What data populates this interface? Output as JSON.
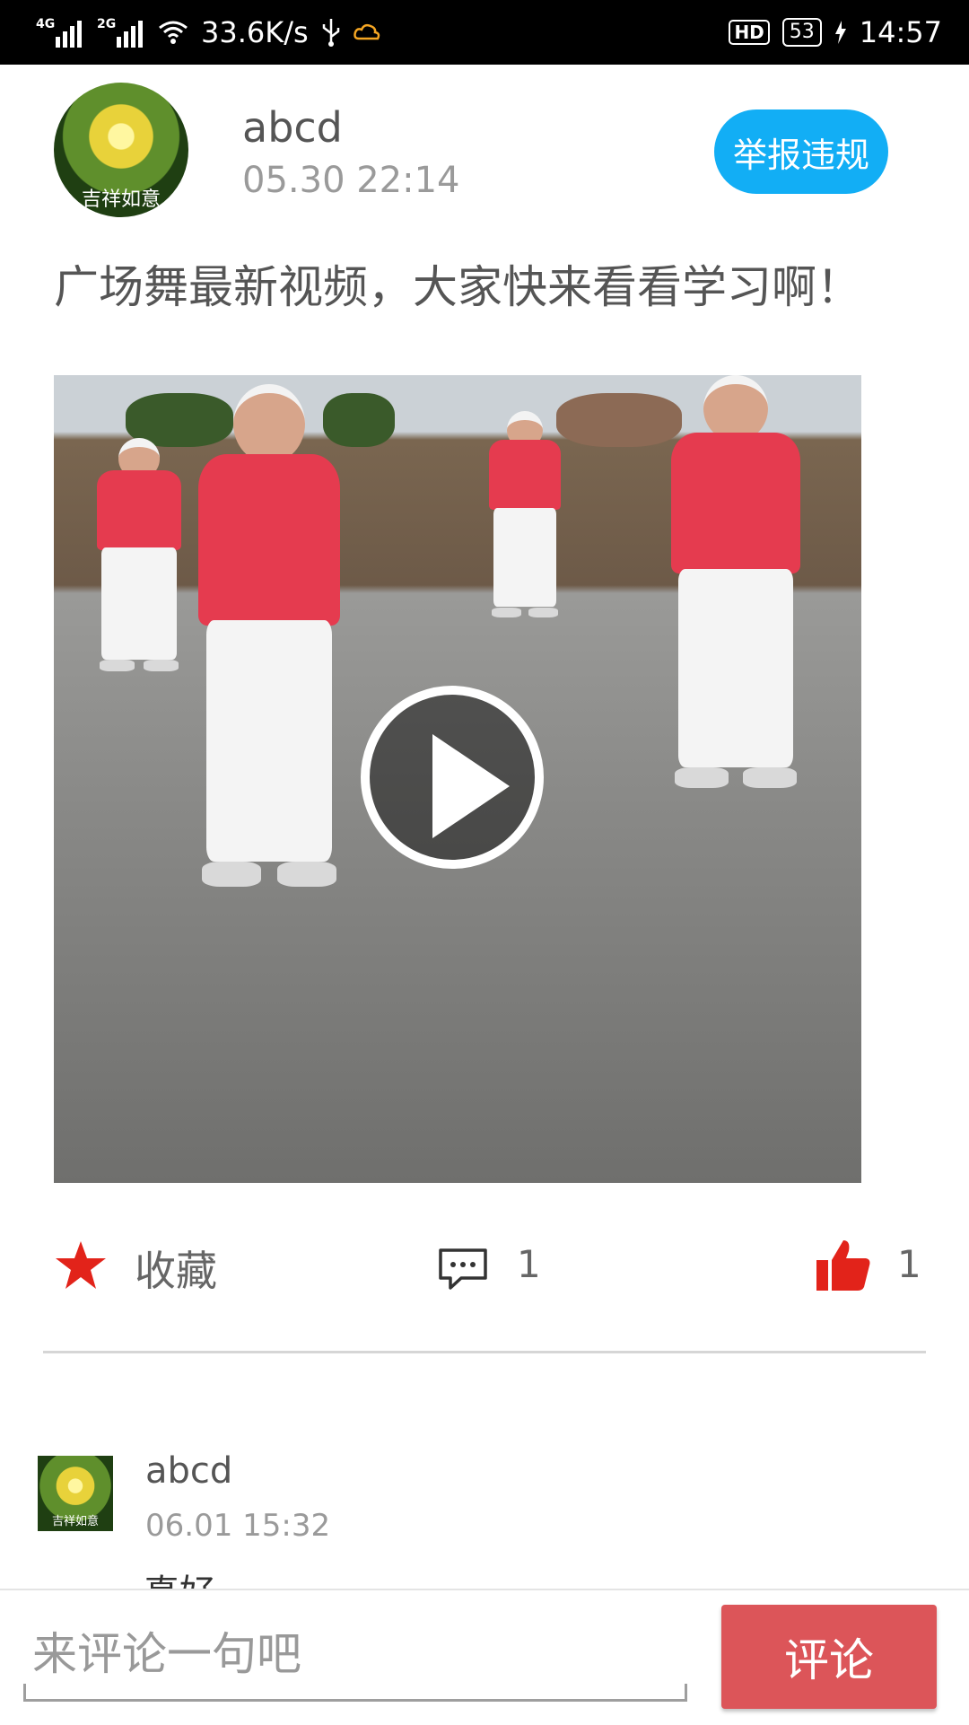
{
  "status_bar": {
    "network_1": "4G",
    "network_2": "2G",
    "speed": "33.6K/s",
    "hd": "HD",
    "battery": "53",
    "time": "14:57"
  },
  "post": {
    "author": "abcd",
    "avatar_caption": "吉祥如意",
    "time": "05.30 22:14",
    "report_label": "举报违规",
    "text": "广场舞最新视频，大家快来看看学习啊！"
  },
  "actions": {
    "favorite_label": "收藏",
    "comment_count": "1",
    "like_count": "1"
  },
  "comments": [
    {
      "user": "abcd",
      "avatar_caption": "吉祥如意",
      "time": "06.01 15:32",
      "text": "真好"
    }
  ],
  "composer": {
    "placeholder": "来评论一句吧",
    "submit_label": "评论"
  },
  "colors": {
    "report_button": "#12aef5",
    "submit_button": "#dc5559",
    "favorite_icon": "#e2231a",
    "like_icon": "#e2231a"
  }
}
